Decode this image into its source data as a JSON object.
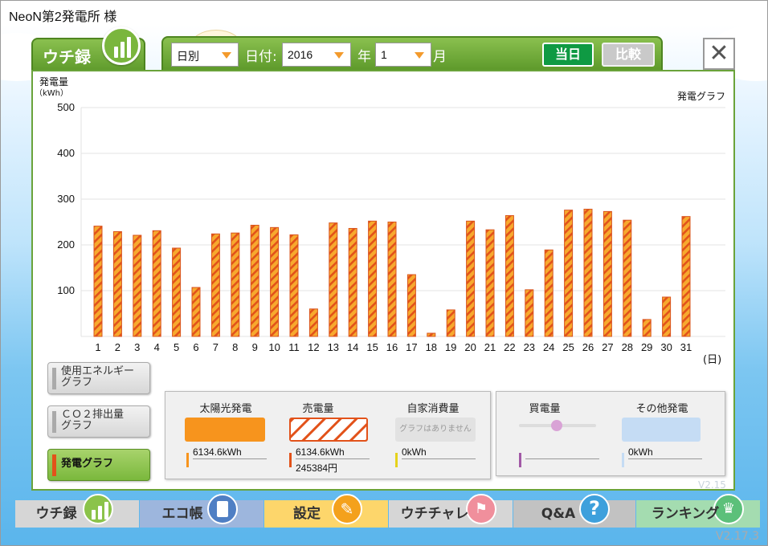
{
  "header": {
    "owner": "NeoN第2発電所 様"
  },
  "tab": {
    "label": "ウチ録"
  },
  "toolbar": {
    "period_select": "日別",
    "date_label": "日付:",
    "year_select": "2016",
    "year_label": "年",
    "month_select": "1",
    "month_label": "月",
    "today_button": "当日",
    "compare_button": "比較",
    "close_button": "✕"
  },
  "chart_data": {
    "type": "bar",
    "ylabel": "発電量",
    "yunit": "（kWh）",
    "xunit": "(日)",
    "legend_title": "発電グラフ",
    "ylim": [
      0,
      500
    ],
    "yticks": [
      100,
      200,
      300,
      400,
      500
    ],
    "categories": [
      "1",
      "2",
      "3",
      "4",
      "5",
      "6",
      "7",
      "8",
      "9",
      "10",
      "11",
      "12",
      "13",
      "14",
      "15",
      "16",
      "17",
      "18",
      "19",
      "20",
      "21",
      "22",
      "23",
      "24",
      "25",
      "26",
      "27",
      "28",
      "29",
      "30",
      "31"
    ],
    "series": [
      {
        "name": "売電量",
        "values": [
          241,
          229,
          221,
          231,
          193,
          107,
          224,
          226,
          243,
          238,
          222,
          60,
          248,
          236,
          252,
          250,
          135,
          7,
          58,
          252,
          233,
          264,
          102,
          189,
          276,
          278,
          273,
          254,
          37,
          86,
          262
        ]
      }
    ]
  },
  "side_buttons": {
    "energy": "使用エネルギーグラフ",
    "co2": "ＣＯ２排出量グラフ",
    "generation": "発電グラフ"
  },
  "legend": {
    "solar": {
      "title": "太陽光発電",
      "value": "6134.6kWh",
      "color": "#f7941d"
    },
    "sold": {
      "title": "売電量",
      "value": "6134.6kWh",
      "yen": "245384円",
      "color": "#e2521a"
    },
    "self": {
      "title": "自家消費量",
      "note": "グラフはありません",
      "value": "0kWh",
      "color": "#e5d21b"
    },
    "bought": {
      "title": "買電量",
      "color": "#a259a6"
    },
    "other": {
      "title": "その他発電",
      "value": "0kWh",
      "color": "#c5dcf4"
    }
  },
  "nav": {
    "uchiroku": "ウチ録",
    "ecocho": "エコ帳",
    "settings": "設定",
    "uchichare": "ウチチャレ",
    "qa": "Q&A",
    "ranking": "ランキング"
  },
  "version": {
    "app": "V2.17.3",
    "panel": "V2.15"
  }
}
